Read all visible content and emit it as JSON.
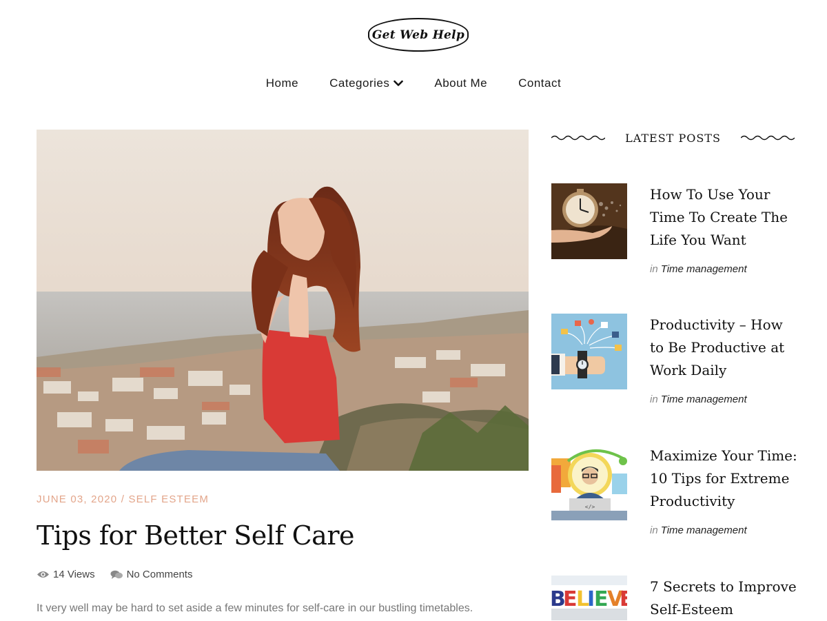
{
  "header": {
    "logo_text": "Get Web Help",
    "nav": {
      "home": "Home",
      "categories": "Categories",
      "about": "About Me",
      "contact": "Contact"
    }
  },
  "article": {
    "date": "JUNE 03, 2020",
    "separator": "/",
    "category": "SELF ESTEEM",
    "title": "Tips for Better Self Care",
    "views": "14 Views",
    "comments": "No Comments",
    "excerpt": "It very well may be hard to set aside a few minutes for self-care in our bustling timetables.",
    "image_icon": "woman-on-hilltop-photo"
  },
  "sidebar": {
    "heading": "LATEST POSTS",
    "in_label": "in",
    "posts": [
      {
        "title": "How To Use Your Time To Create The Life You Want",
        "category": "Time management",
        "thumb_icon": "clock-in-hand-photo"
      },
      {
        "title": "Productivity – How to Be Productive at Work Daily",
        "category": "Time management",
        "thumb_icon": "wristwatch-illustration"
      },
      {
        "title": "Maximize Your Time: 10 Tips for Extreme Productivity",
        "category": "Time management",
        "thumb_icon": "developer-clock-illustration"
      },
      {
        "title": "7 Secrets to Improve Self-Esteem",
        "category": "",
        "thumb_icon": "believe-letters-photo"
      }
    ]
  },
  "colors": {
    "accent": "#e3a58a",
    "text": "#111111",
    "muted": "#777777"
  }
}
